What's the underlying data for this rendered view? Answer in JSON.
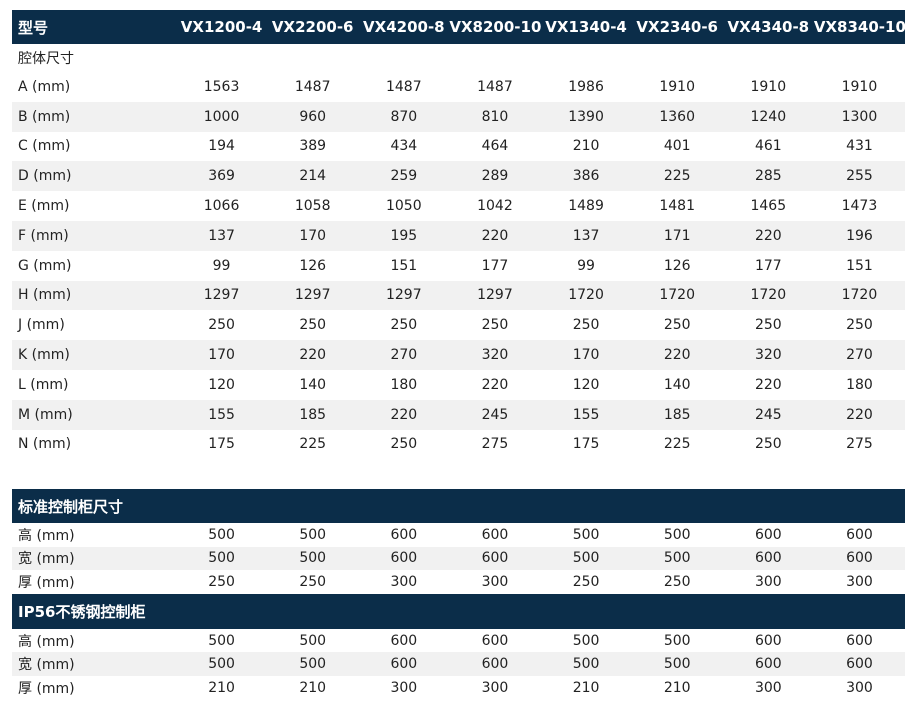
{
  "header": {
    "first": "型号",
    "models": [
      "VX1200-4",
      "VX2200-6",
      "VX4200-8",
      "VX8200-10",
      "VX1340-4",
      "VX2340-6",
      "VX4340-8",
      "VX8340-10"
    ]
  },
  "section1": {
    "title": "腔体尺寸",
    "rows": [
      {
        "label": "A (mm)",
        "values": [
          "1563",
          "1487",
          "1487",
          "1487",
          "1986",
          "1910",
          "1910",
          "1910"
        ]
      },
      {
        "label": "B (mm)",
        "values": [
          "1000",
          "960",
          "870",
          "810",
          "1390",
          "1360",
          "1240",
          "1300"
        ]
      },
      {
        "label": "C (mm)",
        "values": [
          "194",
          "389",
          "434",
          "464",
          "210",
          "401",
          "461",
          "431"
        ]
      },
      {
        "label": "D (mm)",
        "values": [
          "369",
          "214",
          "259",
          "289",
          "386",
          "225",
          "285",
          "255"
        ]
      },
      {
        "label": "E (mm)",
        "values": [
          "1066",
          "1058",
          "1050",
          "1042",
          "1489",
          "1481",
          "1465",
          "1473"
        ]
      },
      {
        "label": "F (mm)",
        "values": [
          "137",
          "170",
          "195",
          "220",
          "137",
          "171",
          "220",
          "196"
        ]
      },
      {
        "label": "G (mm)",
        "values": [
          "99",
          "126",
          "151",
          "177",
          "99",
          "126",
          "177",
          "151"
        ]
      },
      {
        "label": "H (mm)",
        "values": [
          "1297",
          "1297",
          "1297",
          "1297",
          "1720",
          "1720",
          "1720",
          "1720"
        ]
      },
      {
        "label": "J (mm)",
        "values": [
          "250",
          "250",
          "250",
          "250",
          "250",
          "250",
          "250",
          "250"
        ]
      },
      {
        "label": "K (mm)",
        "values": [
          "170",
          "220",
          "270",
          "320",
          "170",
          "220",
          "320",
          "270"
        ]
      },
      {
        "label": "L (mm)",
        "values": [
          "120",
          "140",
          "180",
          "220",
          "120",
          "140",
          "220",
          "180"
        ]
      },
      {
        "label": "M (mm)",
        "values": [
          "155",
          "185",
          "220",
          "245",
          "155",
          "185",
          "245",
          "220"
        ]
      },
      {
        "label": "N (mm)",
        "values": [
          "175",
          "225",
          "250",
          "275",
          "175",
          "225",
          "250",
          "275"
        ]
      }
    ]
  },
  "section2": {
    "title": "标准控制柜尺寸",
    "rows": [
      {
        "label": "高 (mm)",
        "values": [
          "500",
          "500",
          "600",
          "600",
          "500",
          "500",
          "600",
          "600"
        ]
      },
      {
        "label": "宽 (mm)",
        "values": [
          "500",
          "500",
          "600",
          "600",
          "500",
          "500",
          "600",
          "600"
        ]
      },
      {
        "label": "厚 (mm)",
        "values": [
          "250",
          "250",
          "300",
          "300",
          "250",
          "250",
          "300",
          "300"
        ]
      }
    ]
  },
  "section3": {
    "title": "IP56不锈钢控制柜",
    "rows": [
      {
        "label": "高 (mm)",
        "values": [
          "500",
          "500",
          "600",
          "600",
          "500",
          "500",
          "600",
          "600"
        ]
      },
      {
        "label": "宽 (mm)",
        "values": [
          "500",
          "500",
          "600",
          "600",
          "500",
          "500",
          "600",
          "600"
        ]
      },
      {
        "label": "厚 (mm)",
        "values": [
          "210",
          "210",
          "300",
          "300",
          "210",
          "210",
          "300",
          "300"
        ]
      }
    ]
  },
  "colors": {
    "header_bg": "#0b2d49",
    "header_text": "#ffffff",
    "alt_row": "#f1f1f1"
  }
}
